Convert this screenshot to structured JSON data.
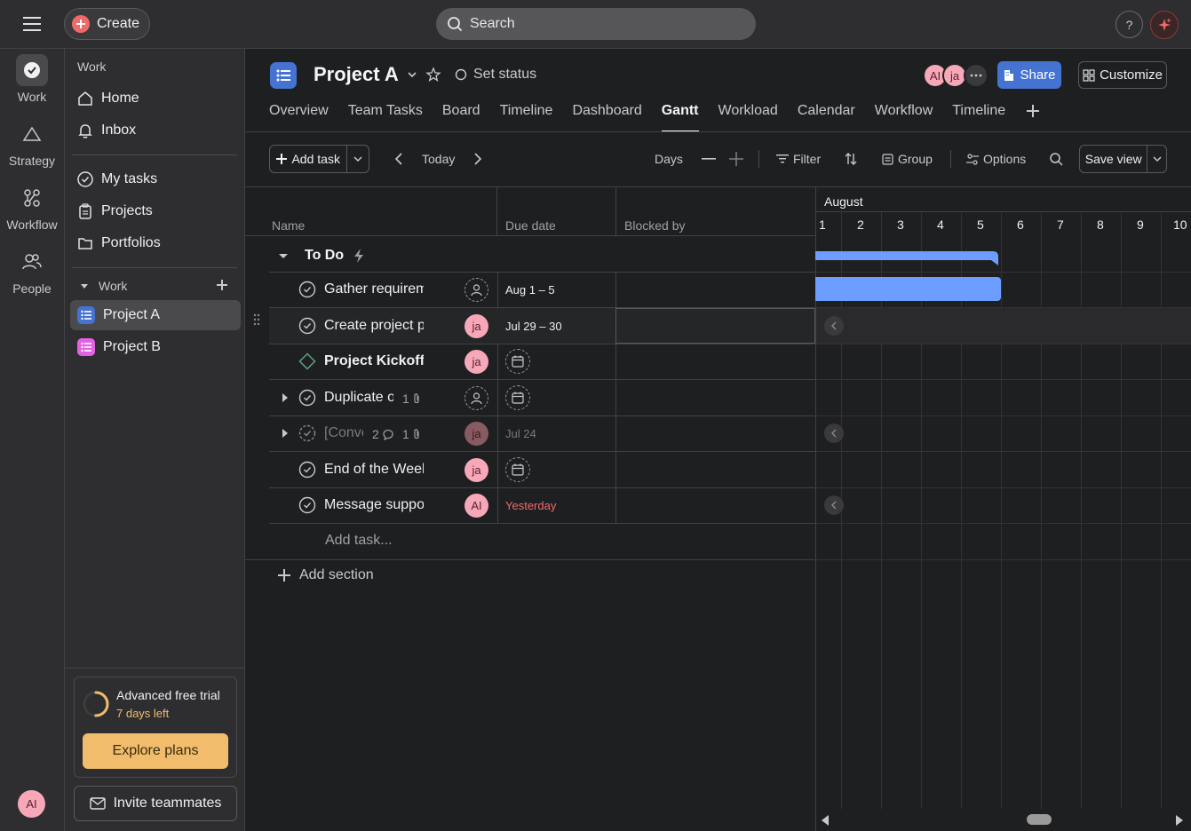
{
  "topbar": {
    "create_label": "Create",
    "search_placeholder": "Search",
    "help_label": "?"
  },
  "rail": {
    "items": [
      {
        "label": "Work",
        "icon": "check-circle-icon"
      },
      {
        "label": "Strategy",
        "icon": "triangle-icon"
      },
      {
        "label": "Workflow",
        "icon": "workflow-icon"
      },
      {
        "label": "People",
        "icon": "people-icon"
      }
    ],
    "user_initials": "AI"
  },
  "sidebar": {
    "section_label": "Work",
    "top_items": [
      {
        "label": "Home",
        "icon": "home-icon"
      },
      {
        "label": "Inbox",
        "icon": "bell-icon"
      }
    ],
    "mid_items": [
      {
        "label": "My tasks",
        "icon": "check-circle-icon"
      },
      {
        "label": "Projects",
        "icon": "clipboard-icon"
      },
      {
        "label": "Portfolios",
        "icon": "folder-icon"
      }
    ],
    "work_group_label": "Work",
    "projects": [
      {
        "label": "Project A",
        "color": "#4573d2"
      },
      {
        "label": "Project B",
        "color": "#e362e3"
      }
    ],
    "trial": {
      "title": "Advanced free trial",
      "days_left": "7 days left",
      "button": "Explore plans",
      "progress_fraction": 0.5
    },
    "invite_label": "Invite teammates"
  },
  "header": {
    "project_title": "Project A",
    "set_status": "Set status",
    "members": [
      "AI",
      "ja"
    ],
    "share_label": "Share",
    "customize_label": "Customize",
    "tabs": [
      "Overview",
      "Team Tasks",
      "Board",
      "Timeline",
      "Dashboard",
      "Gantt",
      "Workload",
      "Calendar",
      "Workflow",
      "Timeline"
    ],
    "active_tab": "Gantt"
  },
  "toolbar": {
    "add_task": "Add task",
    "today": "Today",
    "days": "Days",
    "filter": "Filter",
    "group": "Group",
    "options": "Options",
    "save_view": "Save view"
  },
  "grid": {
    "columns": {
      "name": "Name",
      "due": "Due date",
      "blocked": "Blocked by"
    },
    "section": "To Do",
    "tasks": [
      {
        "name": "Gather requirements",
        "assignee": "",
        "due": "Aug 1 – 5",
        "type": "task"
      },
      {
        "name": "Create project plan",
        "assignee": "ja",
        "due": "Jul 29 – 30",
        "type": "task"
      },
      {
        "name": "Project Kickoff",
        "assignee": "ja",
        "due": "",
        "type": "milestone"
      },
      {
        "name": "Duplicate of",
        "assignee": "",
        "due": "",
        "type": "task",
        "attachments": "1",
        "expandable": true
      },
      {
        "name": "[Conversation]",
        "assignee": "ja",
        "due": "Jul 24",
        "type": "task",
        "comments": "2",
        "attachments": "1",
        "expandable": true,
        "completed": true
      },
      {
        "name": "End of the Week",
        "assignee": "ja",
        "due": "",
        "type": "task"
      },
      {
        "name": "Message support",
        "assignee": "AI",
        "due": "Yesterday",
        "type": "task",
        "overdue": true
      }
    ],
    "add_task": "Add task...",
    "add_section": "Add section"
  },
  "gantt": {
    "month": "August",
    "days": [
      "1",
      "2",
      "3",
      "4",
      "5",
      "6",
      "7",
      "8",
      "9",
      "10"
    ],
    "bar_color": "#6d9eff"
  }
}
